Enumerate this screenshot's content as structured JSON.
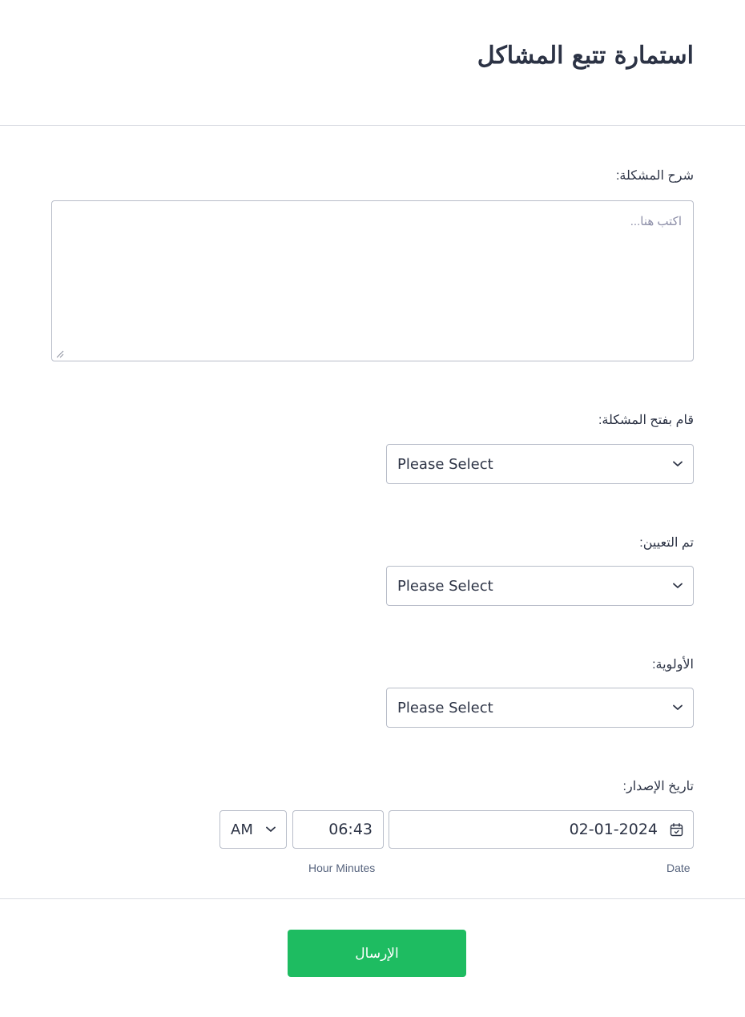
{
  "form": {
    "title": "استمارة تتبع المشاكل"
  },
  "fields": {
    "description": {
      "label": "شرح المشكلة:",
      "placeholder": "اكتب هنا...",
      "value": ""
    },
    "opened_by": {
      "label": "قام بفتح المشكلة:",
      "value": "Please Select"
    },
    "assigned_to": {
      "label": "تم التعيين:",
      "value": "Please Select"
    },
    "priority": {
      "label": "الأولوية:",
      "value": "Please Select"
    },
    "issue_date": {
      "label": "تاريخ الإصدار:",
      "date": "02-01-2024",
      "time": "06:43",
      "ampm": "AM",
      "date_sublabel": "Date",
      "time_sublabel": "Hour Minutes"
    }
  },
  "submit": {
    "label": "الإرسال"
  },
  "icons": {
    "select_chevron": "chevron-down-icon",
    "date_picker": "calendar-icon",
    "textarea_resize": "resize-grip-icon"
  },
  "colors": {
    "submit_bg": "#1ebc61",
    "text": "#2c3345",
    "border": "#b8bdc9",
    "divider": "#dadde3",
    "sublabel": "#57647e",
    "placeholder": "#8d8fa8"
  }
}
